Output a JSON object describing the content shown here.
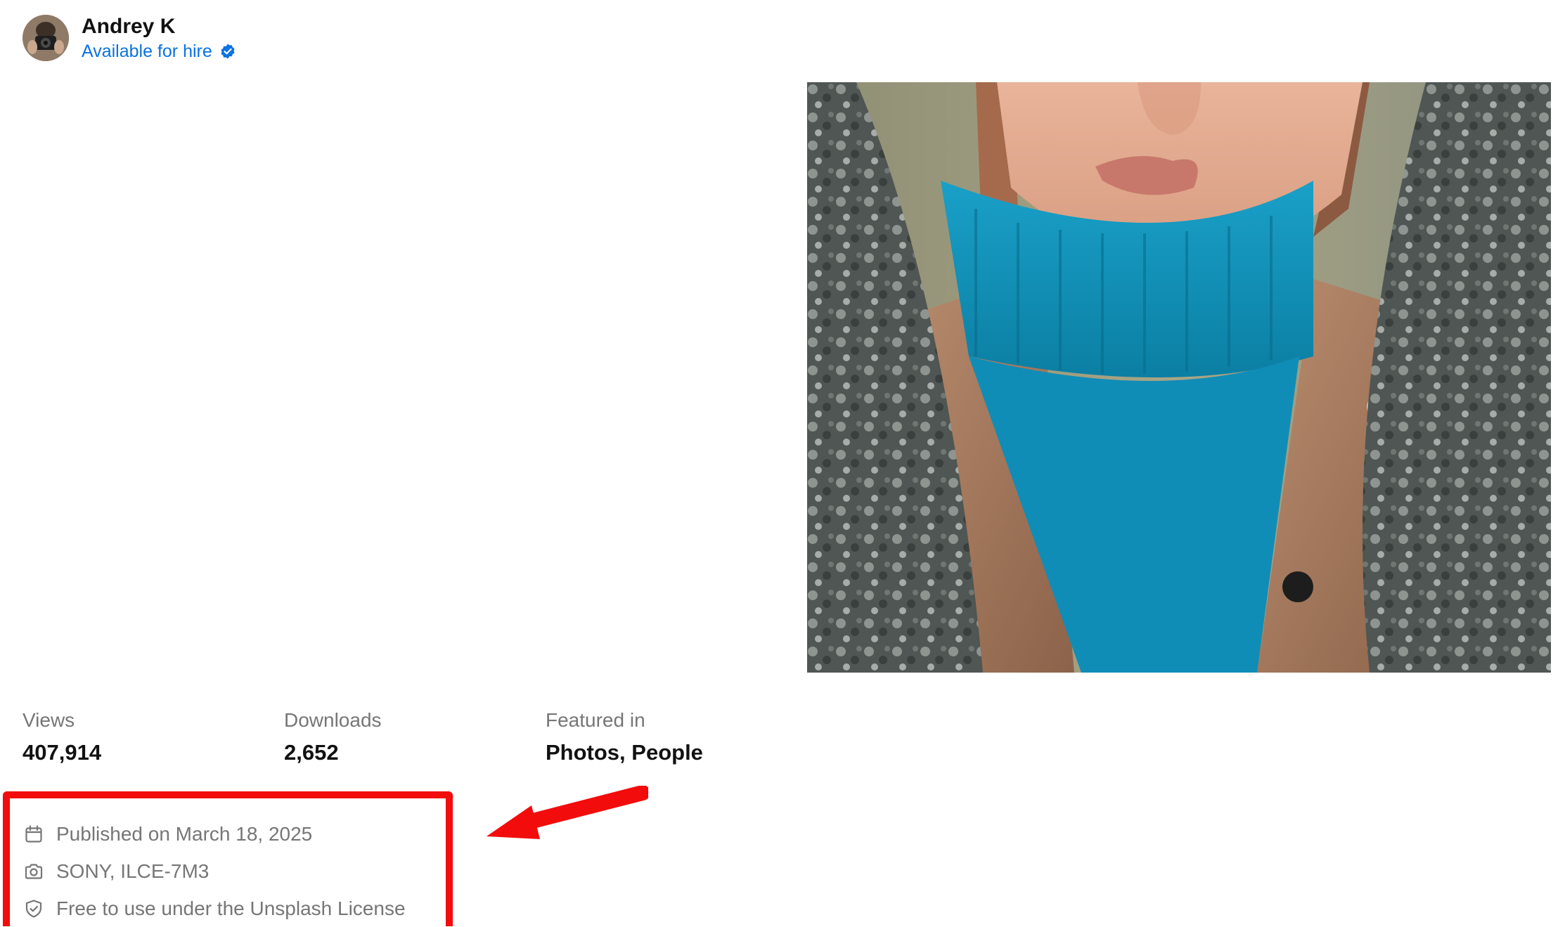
{
  "author": {
    "name": "Andrey K",
    "hire_label": "Available for hire",
    "verified_icon": "verified-check-icon",
    "avatar_icon": "avatar-photo"
  },
  "photo": {
    "subject": "woman in blue turtleneck and brown leather jacket"
  },
  "stats": {
    "views_label": "Views",
    "views_value": "407,914",
    "downloads_label": "Downloads",
    "downloads_value": "2,652",
    "featured_label": "Featured in",
    "featured_value": "Photos, People"
  },
  "info": {
    "published": "Published on March 18, 2025",
    "camera": "SONY, ILCE-7M3",
    "license": "Free to use under the Unsplash License",
    "icons": [
      "calendar-icon",
      "camera-icon",
      "shield-check-icon"
    ]
  },
  "colors": {
    "accent_blue": "#0a73e0",
    "highlight_red": "#f20c0c",
    "muted_text": "#767676"
  }
}
